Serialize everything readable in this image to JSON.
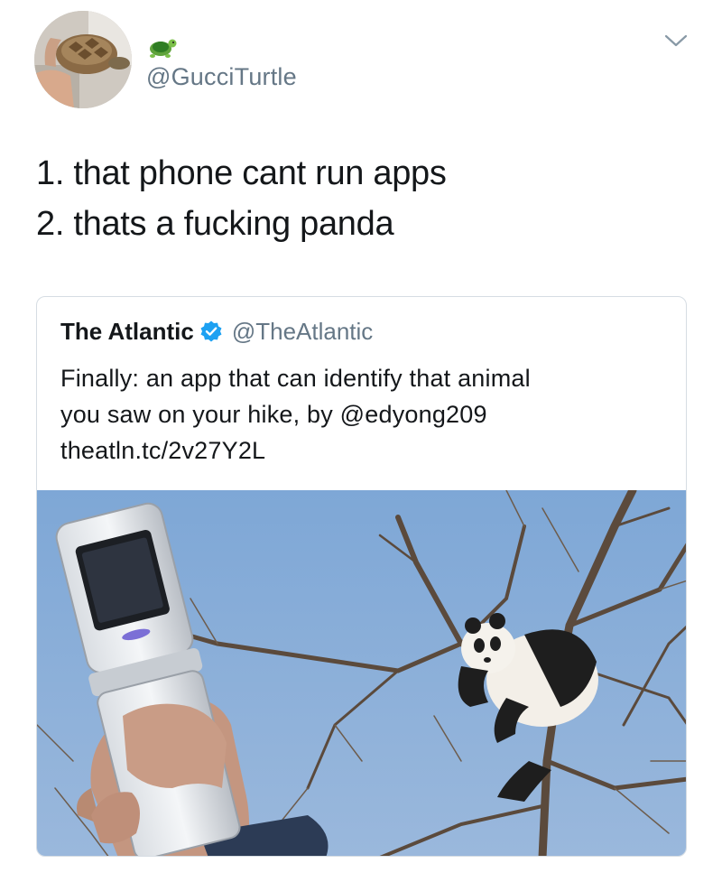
{
  "tweet": {
    "handle": "@GucciTurtle",
    "avatar_icon": "turtle-avatar-icon",
    "name_emoji_icon": "turtle-emoji-icon",
    "menu_icon": "chevron-down-icon",
    "lines": [
      "1. that phone cant run apps",
      "2. thats a fucking panda"
    ]
  },
  "quoted_tweet": {
    "name": "The Atlantic",
    "verified_icon": "verified-badge-icon",
    "handle": "@TheAtlantic",
    "lines": [
      "Finally: an app that can identify that animal",
      "you saw on your hike, by @edyong209",
      "theatln.tc/2v27Y2L"
    ],
    "media": {
      "description_icon": "panda-in-tree-photo",
      "colors": {
        "sky": "#8aaed6",
        "accent": "#1da1f2"
      }
    }
  }
}
